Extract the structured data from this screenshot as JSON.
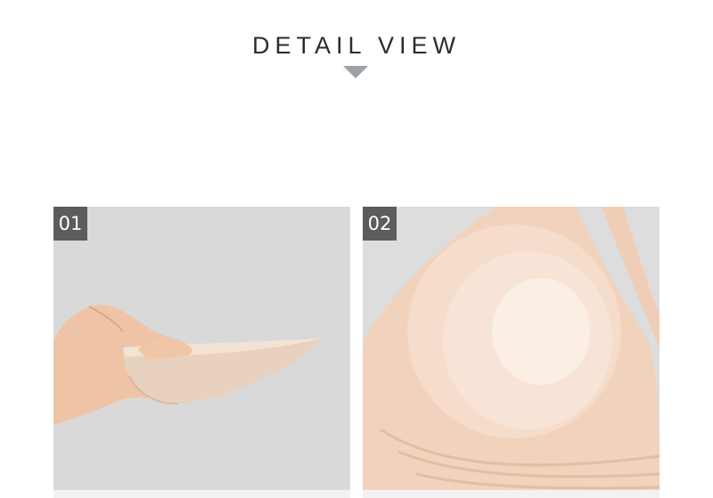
{
  "header": {
    "title": "DETAIL VIEW"
  },
  "panels": [
    {
      "number": "01",
      "icon": "hand-holding-bra-pad"
    },
    {
      "number": "02",
      "icon": "bra-cup-closeup"
    }
  ],
  "colors": {
    "title_text": "#2c2c2c",
    "arrow": "#9aa3a8",
    "badge_bg": "#5c5c5c",
    "panel_bg": "#d8d8d8",
    "skin": "#f0c8ae",
    "foam_pad": "#e9d3c1",
    "bra_fabric": "#f1d4c0"
  }
}
